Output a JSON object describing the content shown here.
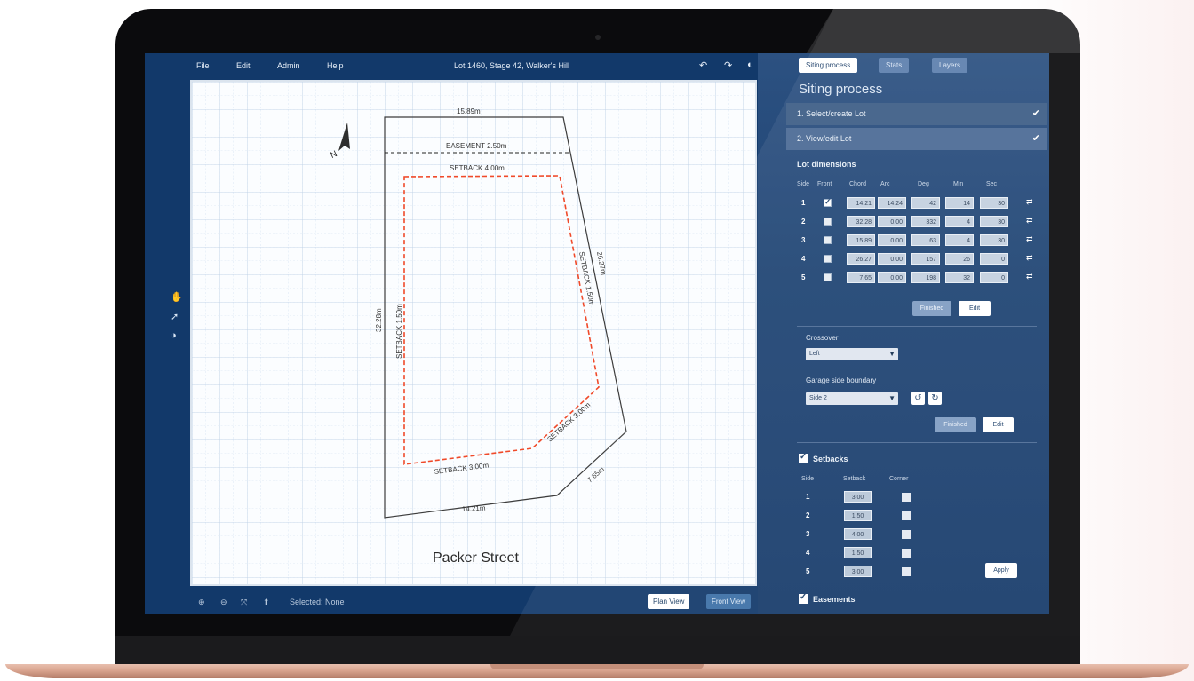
{
  "menu": [
    "File",
    "Edit",
    "Admin",
    "Help"
  ],
  "doc_title": "Lot 1460, Stage 42, Walker's Hill",
  "toolbar_icons": [
    "undo-icon",
    "redo-icon",
    "contrast-toggle-icon"
  ],
  "left_tools": [
    "hand-icon",
    "pointer-icon",
    "contrast-icon"
  ],
  "plan": {
    "north_label": "N",
    "labels": {
      "top": "15.89m",
      "easement": "EASEMENT 2.50m",
      "setback_top": "SETBACK 4.00m",
      "left": "32.28m",
      "right": "26.27m",
      "setback_left": "SETBACK 1.50m",
      "setback_right": "SETBACK 1.50m",
      "setback_bottom": "SETBACK 3.00m",
      "setback_corner": "SETBACK 3.00m",
      "bottom_right": "7.65m",
      "bottom": "14.21m"
    },
    "street": "Packer Street"
  },
  "bottom_bar": {
    "icons": [
      "zoom-in-icon",
      "zoom-out-icon",
      "fit-icon",
      "pin-icon"
    ],
    "selected": "Selected: None",
    "plan_view": "Plan View",
    "front_view": "Front View"
  },
  "panel": {
    "tabs": [
      "Siting process",
      "Stats",
      "Layers"
    ],
    "title": "Siting process",
    "step1": "1. Select/create Lot",
    "step2": "2. View/edit Lot",
    "lot_dimensions": {
      "title": "Lot dimensions",
      "headers": [
        "Side",
        "Front",
        "Chord",
        "Arc",
        "Deg",
        "Min",
        "Sec"
      ],
      "rows": [
        {
          "side": "1",
          "front": true,
          "chord": "14.21",
          "arc": "14.24",
          "deg": "42",
          "min": "14",
          "sec": "30"
        },
        {
          "side": "2",
          "front": false,
          "chord": "32.28",
          "arc": "0.00",
          "deg": "332",
          "min": "4",
          "sec": "30"
        },
        {
          "side": "3",
          "front": false,
          "chord": "15.89",
          "arc": "0.00",
          "deg": "63",
          "min": "4",
          "sec": "30"
        },
        {
          "side": "4",
          "front": false,
          "chord": "26.27",
          "arc": "0.00",
          "deg": "157",
          "min": "26",
          "sec": "0"
        },
        {
          "side": "5",
          "front": false,
          "chord": "7.65",
          "arc": "0.00",
          "deg": "198",
          "min": "32",
          "sec": "0"
        }
      ],
      "finished": "Finished",
      "edit": "Edit"
    },
    "crossover": {
      "label": "Crossover",
      "value": "Left"
    },
    "garage": {
      "label": "Garage side boundary",
      "value": "Side 2",
      "finished": "Finished",
      "edit": "Edit"
    },
    "setbacks": {
      "title": "Setbacks",
      "headers": [
        "Side",
        "Setback",
        "Corner"
      ],
      "rows": [
        {
          "side": "1",
          "value": "3.00"
        },
        {
          "side": "2",
          "value": "1.50"
        },
        {
          "side": "3",
          "value": "4.00"
        },
        {
          "side": "4",
          "value": "1.50"
        },
        {
          "side": "5",
          "value": "3.00"
        }
      ],
      "apply": "Apply"
    },
    "easements": {
      "title": "Easements"
    }
  }
}
